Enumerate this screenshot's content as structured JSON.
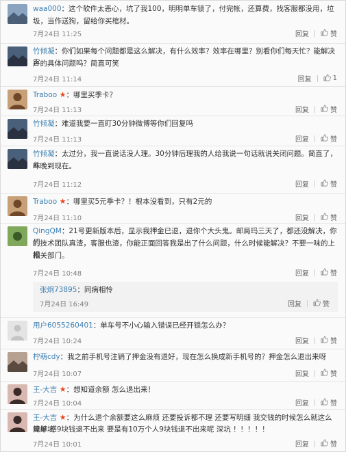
{
  "comments": [
    {
      "user": "waa000",
      "star": false,
      "text1": "：这个软件太恶心，坑了我100，明明单车锁了，付完帐，还算费，找客服都没用，垃",
      "text2": "圾，当作送狗，留给你买棺材。",
      "text3": "",
      "date": "7月24日 11:25",
      "reply": "回复",
      "like": "赞",
      "avatar_icon": "landscape-avatar-icon",
      "colors": [
        "#8aa4c0",
        "#4b6076"
      ]
    },
    {
      "user": "竹倾凝",
      "star": false,
      "text1": "：你们如果每个问题都是这么解决，有什么效率？效率在哪里？别看你们每天忙？能解决客",
      "text2": "户的具体问题吗？简直可笑",
      "text3": "",
      "date": "7月24日 11:14",
      "reply": "回复",
      "like": "1",
      "avatar_icon": "night-scene-avatar-icon",
      "colors": [
        "#4a5f7a",
        "#2a3140"
      ]
    },
    {
      "user": "Traboo",
      "star": true,
      "text1": "：哪里买季卡？",
      "text2": "",
      "text3": "",
      "date": "7月24日 11:13",
      "reply": "回复",
      "like": "赞",
      "avatar_icon": "portrait-avatar-icon",
      "colors": [
        "#c8a078",
        "#704628"
      ]
    },
    {
      "user": "竹倾凝",
      "star": false,
      "text1": "：难道我要一直盯30分钟微博等你们回复吗",
      "text2": "",
      "text3": "",
      "date": "7月24日 11:13",
      "reply": "回复",
      "like": "赞",
      "avatar_icon": "night-scene-avatar-icon",
      "colors": [
        "#4a5f7a",
        "#2a3140"
      ]
    },
    {
      "user": "竹倾凝",
      "star": false,
      "text1": "：太过分，我一直说话没人理。30分钟后理我的人给我说一句话就说关闭问题。简直了，从",
      "text2": "昨晚到现在。",
      "text3": "",
      "date": "7月24日 11:12",
      "reply": "回复",
      "like": "赞",
      "avatar_icon": "night-scene-avatar-icon",
      "colors": [
        "#4a5f7a",
        "#2a3140"
      ]
    },
    {
      "user": "Traboo",
      "star": true,
      "text1": "：哪里买5元季卡？！根本没看到，只有2元的",
      "text2": "",
      "text3": "",
      "date": "7月24日 11:10",
      "reply": "回复",
      "like": "赞",
      "avatar_icon": "portrait-avatar-icon",
      "colors": [
        "#c8a078",
        "#704628"
      ]
    },
    {
      "user": "QingQM",
      "star": false,
      "text1": "：21号更新版本后，显示我押金已退，退你个大头鬼。邮局玛三天了，都还没解决，你们",
      "text2": "的技术团队真渣，客服也渣，你能正面回答我是出了什么问题，什么时候能解决？不要一味的上报",
      "text3": "相关部门。",
      "date": "7月24日 10:48",
      "reply": "回复",
      "like": "赞",
      "avatar_icon": "flower-avatar-icon",
      "colors": [
        "#7fa85a",
        "#3b5a28"
      ],
      "sub": {
        "user": "张炯73895",
        "text": "：同病相怜",
        "date": "7月24日 16:49",
        "reply": "回复",
        "like": "赞"
      }
    },
    {
      "user": "用户6055260401",
      "star": false,
      "text1": "：单车号不小心输入错误已经开锁怎么办？",
      "text2": "",
      "text3": "",
      "date": "7月24日 10:24",
      "reply": "回复",
      "like": "赞",
      "avatar_icon": "default-user-avatar-icon",
      "colors": [
        "#e4e4e4",
        "#c4c4c4"
      ]
    },
    {
      "user": "柠萌cdy",
      "star": false,
      "text1": "：我之前手机号注销了押金没有退好，现在怎么换成新手机号的？押金怎么退出来呀",
      "text2": "",
      "text3": "",
      "date": "7月24日 10:07",
      "reply": "回复",
      "like": "赞",
      "avatar_icon": "cartoon-avatar-icon",
      "colors": [
        "#b6a090",
        "#5a4a40"
      ]
    },
    {
      "user": "王-大吉",
      "star": true,
      "text1": "：想知道余额 怎么退出来！",
      "text2": "",
      "text3": "",
      "date": "7月24日 10:04",
      "reply": "回复",
      "like": "赞",
      "avatar_icon": "woman-avatar-icon",
      "colors": [
        "#d8b8b0",
        "#3a2a28"
      ]
    },
    {
      "user": "王-大吉",
      "star": true,
      "text1": "：为什么退个余额要这么麻烦 还要投诉都不理 还要写明细 我交钱的时候怎么就这么简单 感",
      "text2": "觉好坑 9块钱退不出来 要是有10万个人9块钱退不出来呢 深坑 ！！！！！",
      "text3": "",
      "date": "7月24日 10:01",
      "reply": "回复",
      "like": "赞",
      "avatar_icon": "woman-avatar-icon",
      "colors": [
        "#d8b8b0",
        "#3a2a28"
      ]
    }
  ]
}
